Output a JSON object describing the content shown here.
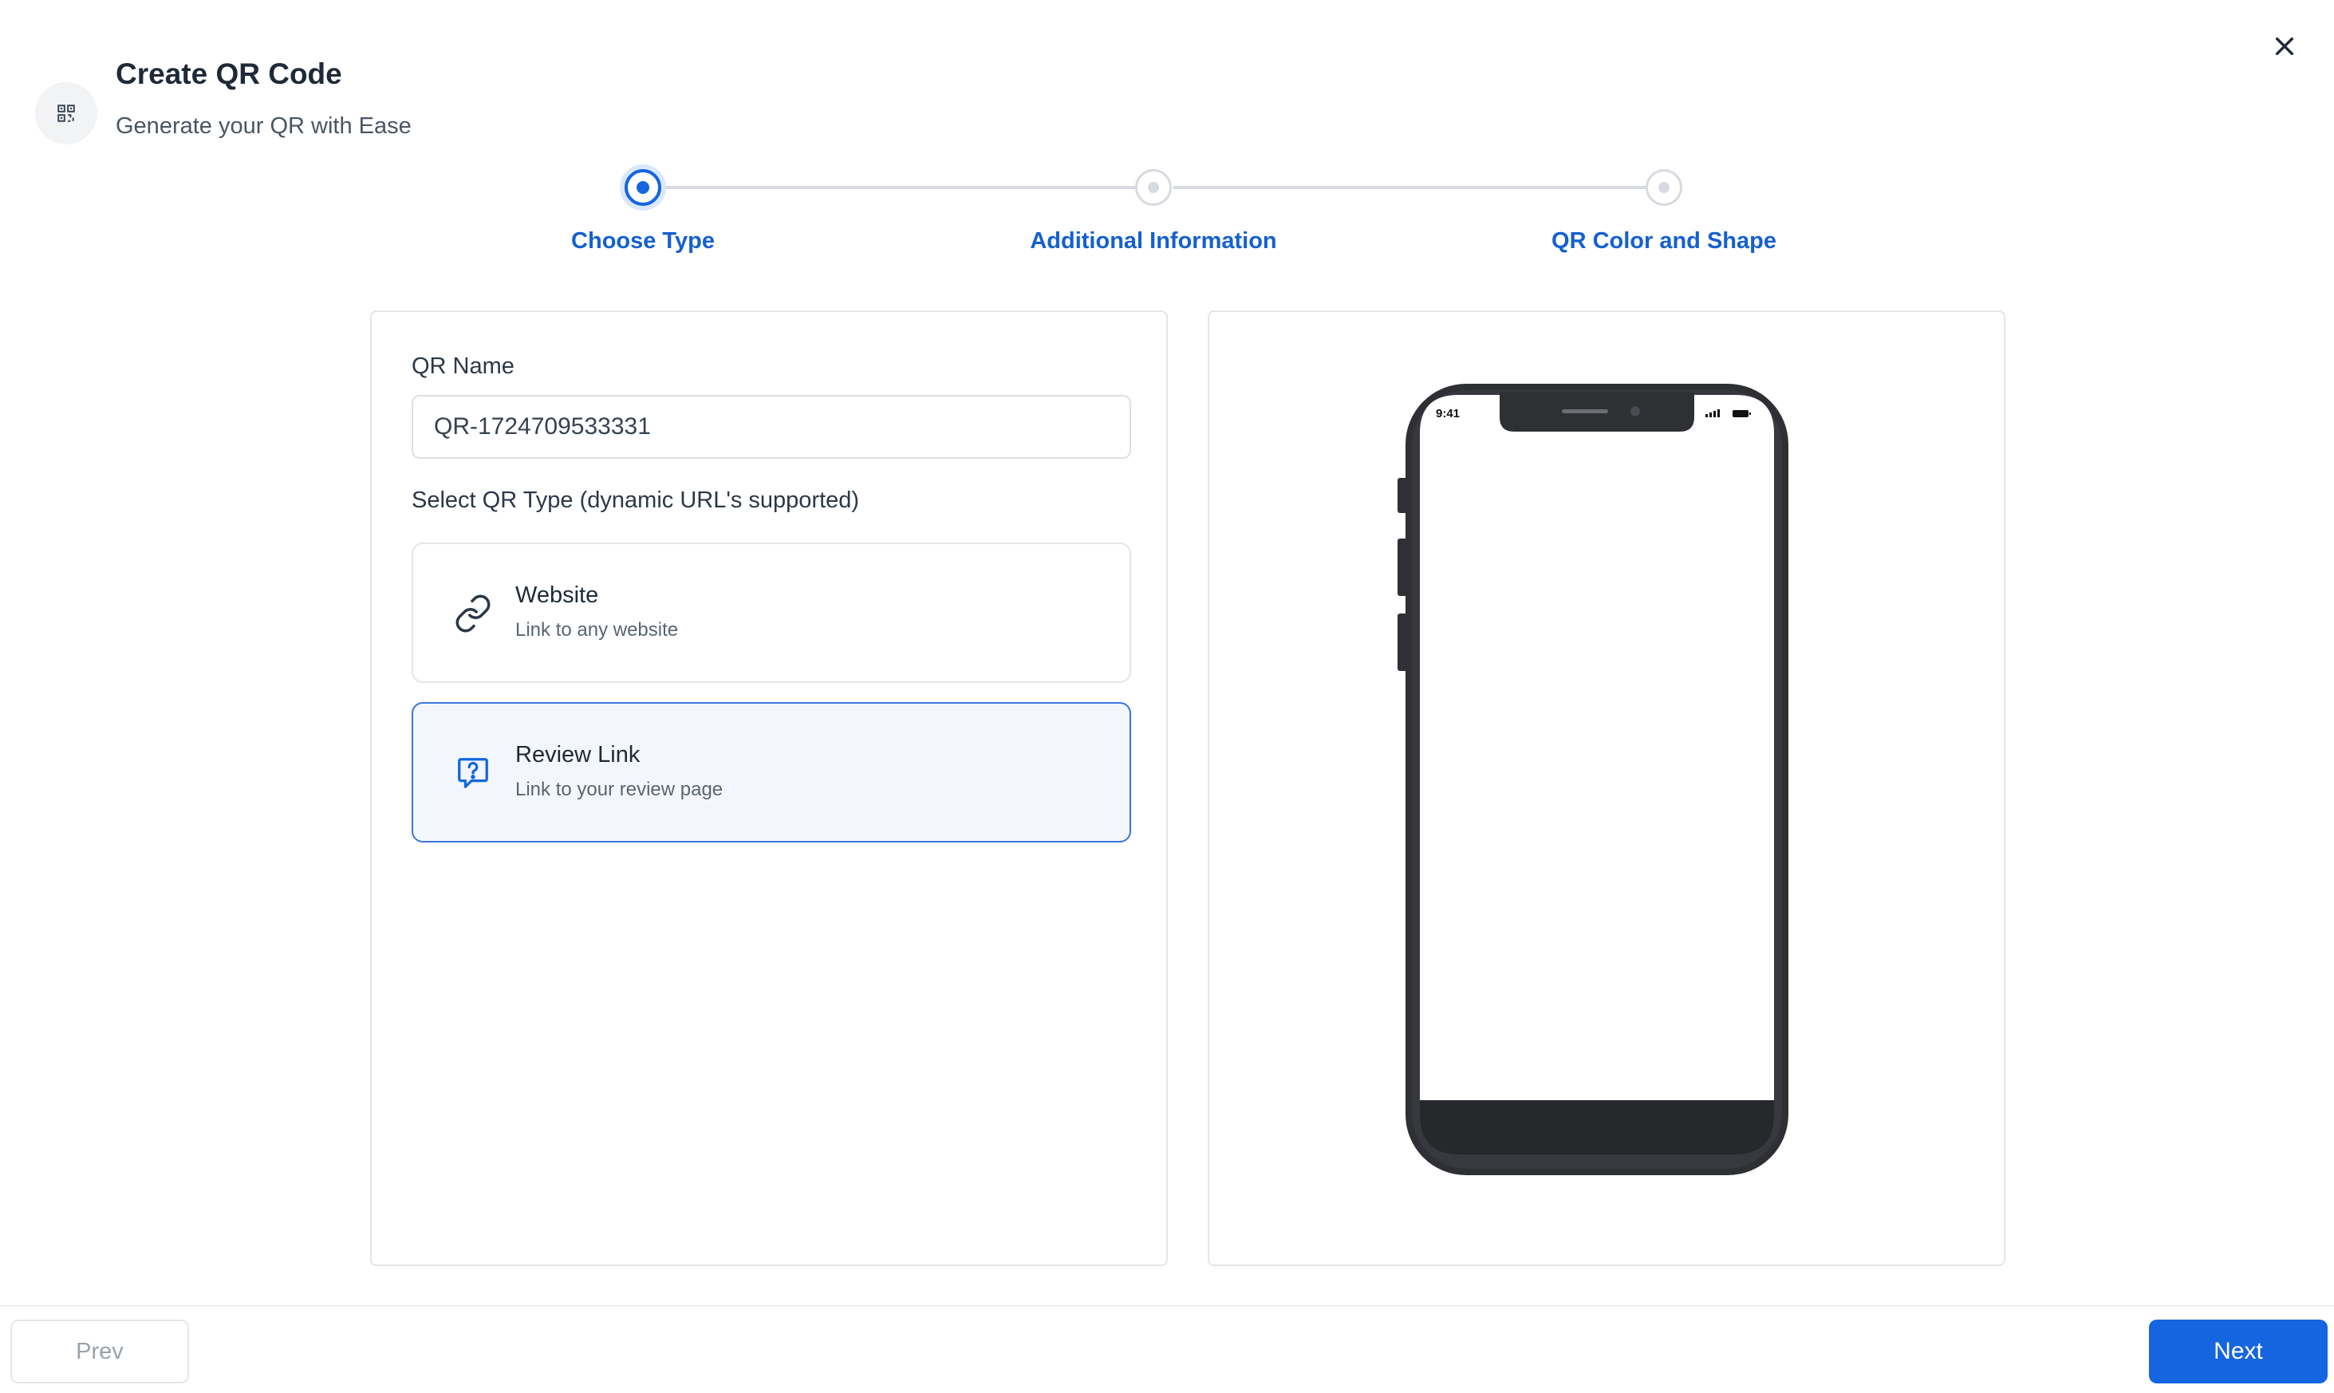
{
  "header": {
    "title": "Create QR Code",
    "subtitle": "Generate your QR with Ease",
    "icon": "qr-code-icon",
    "close_icon": "close-icon"
  },
  "stepper": {
    "steps": [
      {
        "label": "Choose Type",
        "state": "active"
      },
      {
        "label": "Additional Information",
        "state": "inactive"
      },
      {
        "label": "QR Color and Shape",
        "state": "inactive"
      }
    ]
  },
  "form": {
    "qr_name_label": "QR Name",
    "qr_name_value": "QR-1724709533331",
    "type_label": "Select QR Type (dynamic URL's supported)",
    "types": [
      {
        "title": "Website",
        "subtitle": "Link to any website",
        "icon": "link-icon",
        "selected": false
      },
      {
        "title": "Review Link",
        "subtitle": "Link to your review page",
        "icon": "review-question-icon",
        "selected": true
      }
    ]
  },
  "preview": {
    "status_time": "9:41"
  },
  "footer": {
    "prev_label": "Prev",
    "next_label": "Next"
  },
  "colors": {
    "accent": "#1565e0",
    "step_label": "#1560cf",
    "selected_card_bg": "#f3f7fd",
    "selected_card_border": "#3b77dd",
    "phone_body": "#2f3034"
  }
}
